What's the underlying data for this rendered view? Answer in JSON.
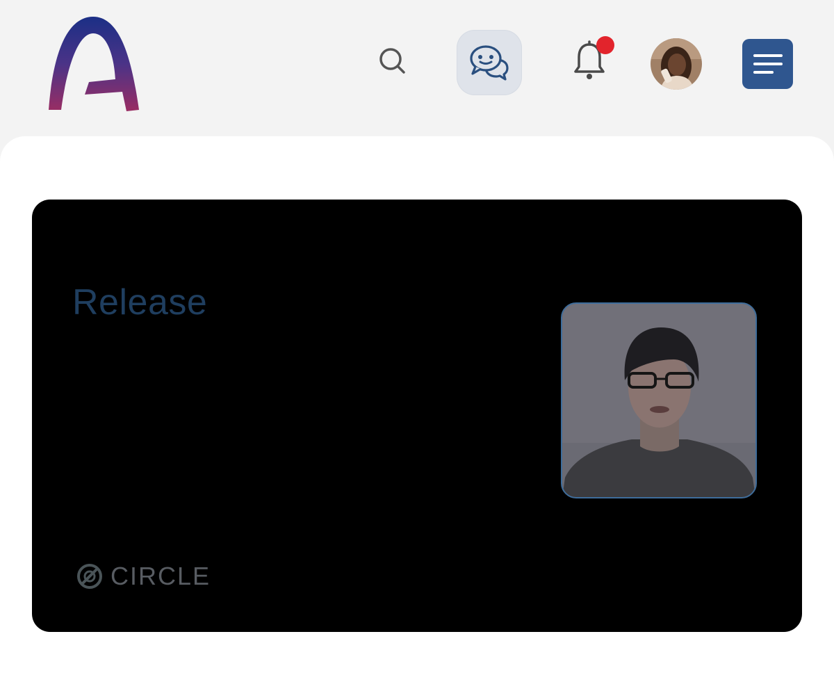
{
  "header": {
    "logo_icon": "app-logo-arch",
    "search_icon": "search-icon",
    "chat_icon": "chat-bubbles-icon",
    "notifications_icon": "bell-icon",
    "menu_icon": "hamburger-menu-icon",
    "colors": {
      "accent": "#2f568f",
      "badge": "#e2242c",
      "logo_top": "#1b2f86",
      "logo_bottom": "#9a2d63"
    }
  },
  "video": {
    "slide_title": "Release",
    "brand_logo_icon": "circle-brand-icon",
    "brand_name": "CIRCLE"
  }
}
